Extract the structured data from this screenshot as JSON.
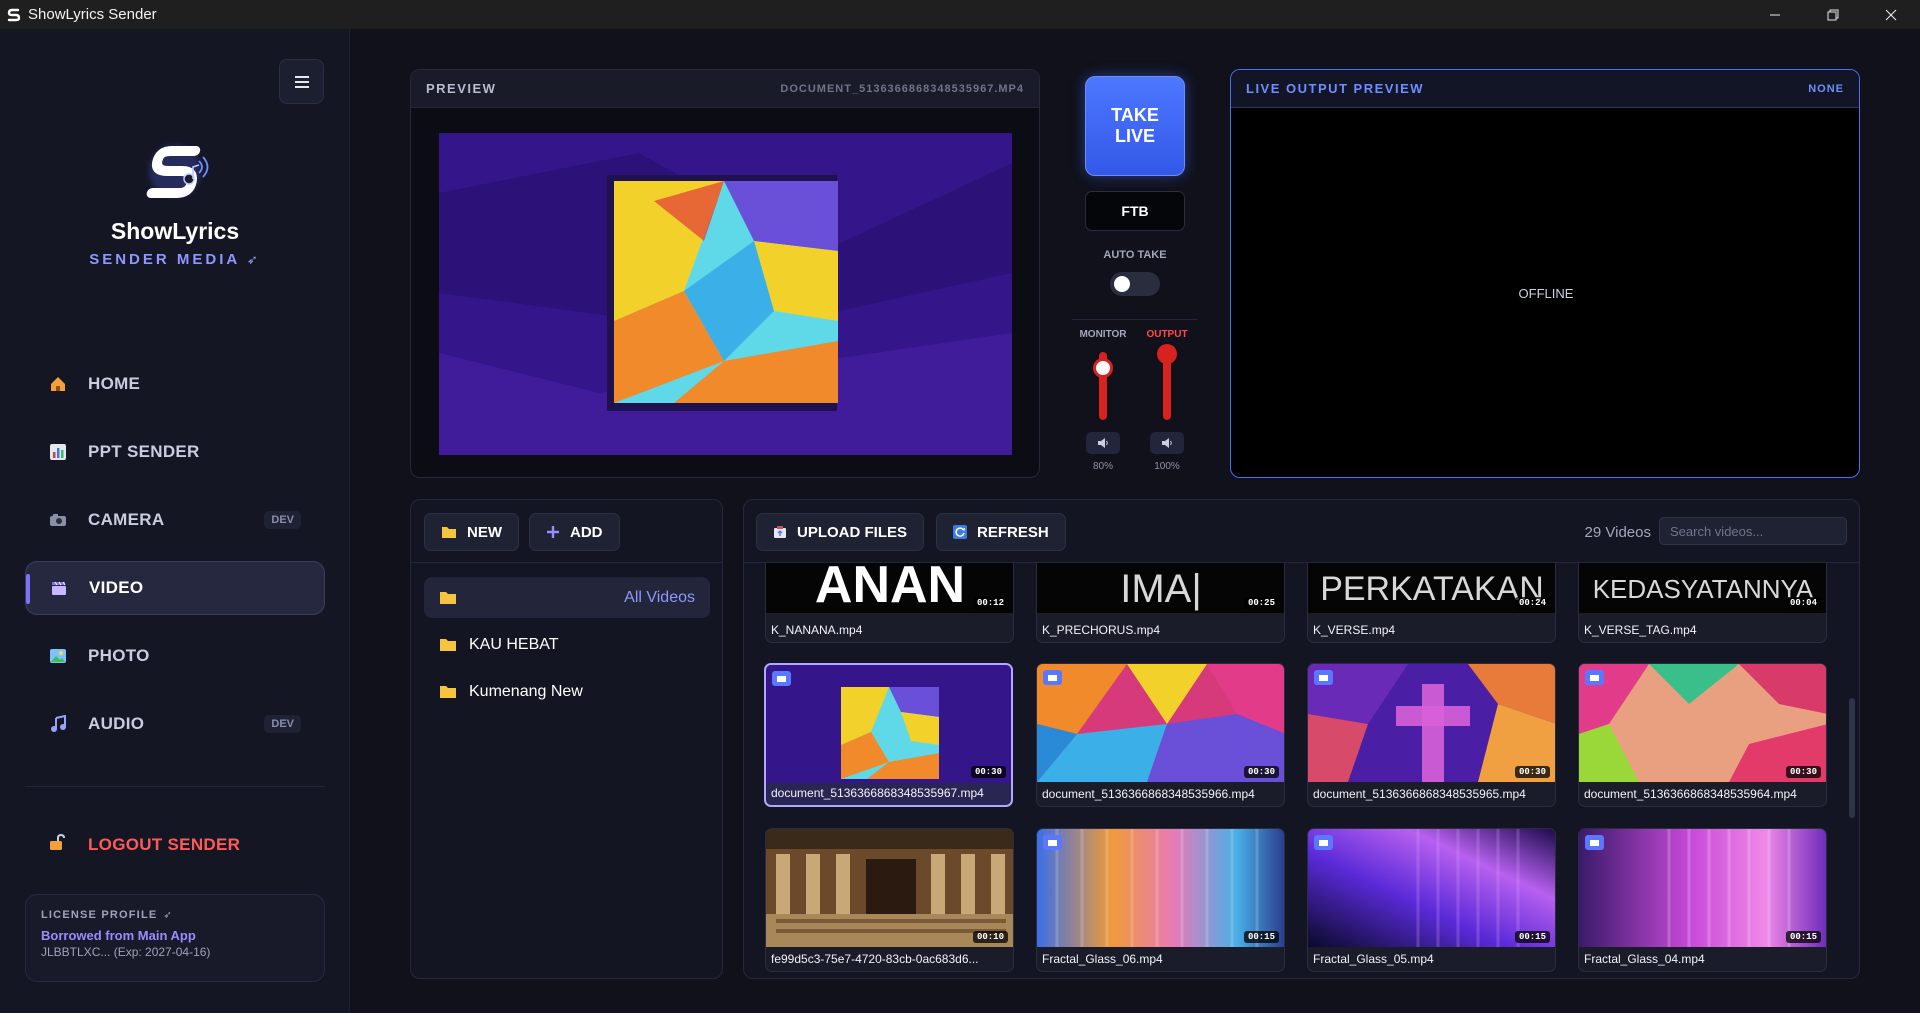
{
  "window": {
    "title": "ShowLyrics Sender"
  },
  "brand": {
    "name": "ShowLyrics",
    "subtitle": "SENDER MEDIA"
  },
  "nav": [
    {
      "label": "HOME",
      "badge": ""
    },
    {
      "label": "PPT SENDER",
      "badge": ""
    },
    {
      "label": "CAMERA",
      "badge": "DEV"
    },
    {
      "label": "VIDEO",
      "badge": "",
      "active": true
    },
    {
      "label": "PHOTO",
      "badge": ""
    },
    {
      "label": "AUDIO",
      "badge": "DEV"
    }
  ],
  "logout": {
    "label": "LOGOUT SENDER"
  },
  "license": {
    "heading": "LICENSE PROFILE",
    "name": "Borrowed from Main App",
    "key": "JLBBTLXC... (Exp: 2027-04-16)"
  },
  "preview": {
    "title": "PREVIEW",
    "file": "DOCUMENT_5136366868348535967.MP4"
  },
  "controls": {
    "take_live": "TAKE LIVE",
    "ftb": "FTB",
    "auto_take": "AUTO TAKE",
    "auto_take_on": false,
    "monitor": {
      "label": "MONITOR",
      "value": "80%",
      "level": 0.8
    },
    "output": {
      "label": "OUTPUT",
      "value": "100%",
      "level": 1.0
    }
  },
  "live_output": {
    "title": "LIVE OUTPUT PREVIEW",
    "source": "NONE",
    "status": "OFFLINE"
  },
  "folders": {
    "new_label": "NEW",
    "add_label": "ADD",
    "items": [
      {
        "label": "All Videos",
        "active": true
      },
      {
        "label": "KAU HEBAT"
      },
      {
        "label": "Kumenang New"
      }
    ]
  },
  "videos": {
    "upload_label": "UPLOAD FILES",
    "refresh_label": "REFRESH",
    "count": "29 Videos",
    "search_placeholder": "Search videos...",
    "items": [
      {
        "name": "K_NANANA.mp4",
        "duration": "00:12",
        "thumb_text": "ANAN"
      },
      {
        "name": "K_PRECHORUS.mp4",
        "duration": "00:25",
        "thumb_text": "IMA|"
      },
      {
        "name": "K_VERSE.mp4",
        "duration": "00:24",
        "thumb_text": "PERKATAKAN"
      },
      {
        "name": "K_VERSE_TAG.mp4",
        "duration": "00:04",
        "thumb_text": "KEDASYATANNYA"
      },
      {
        "name": "document_5136366868348535967.mp4",
        "duration": "00:30",
        "selected": true
      },
      {
        "name": "document_5136366868348535966.mp4",
        "duration": "00:30"
      },
      {
        "name": "document_5136366868348535965.mp4",
        "duration": "00:30"
      },
      {
        "name": "document_5136366868348535964.mp4",
        "duration": "00:30"
      },
      {
        "name": "fe99d5c3-75e7-4720-83cb-0ac683d6...",
        "duration": "00:10"
      },
      {
        "name": "Fractal_Glass_06.mp4",
        "duration": "00:15"
      },
      {
        "name": "Fractal_Glass_05.mp4",
        "duration": "00:15"
      },
      {
        "name": "Fractal_Glass_04.mp4",
        "duration": "00:15"
      }
    ]
  },
  "colors": {
    "accent": "#7e73ff",
    "live_blue": "#4d78ff",
    "danger": "#ff5a5a",
    "fader_red": "#d8221f"
  }
}
